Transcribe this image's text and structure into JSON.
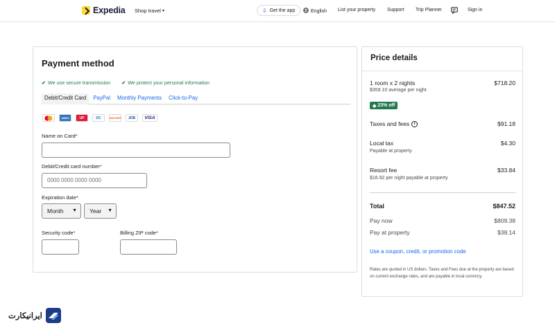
{
  "header": {
    "brand": "Expedia",
    "shop_travel": "Shop travel",
    "get_app": "Get the app",
    "language": "English",
    "list_property": "List your property",
    "support": "Support",
    "trip_planner": "Trip Planner",
    "sign_in": "Sign in"
  },
  "payment": {
    "title": "Payment method",
    "secure_1": "We use secure transmission",
    "secure_2": "We protect your personal information",
    "tabs": [
      "Debit/Credit Card",
      "PayPal",
      "Monthly Payments",
      "Click-to-Pay"
    ],
    "active_tab": "Debit/Credit Card",
    "card_logos": [
      "mastercard-icon",
      "amex-icon",
      "unionpay-icon",
      "diners-icon",
      "discover-icon",
      "jcb-icon",
      "visa-icon"
    ],
    "card_text": {
      "amex": "AMEX",
      "union": "UP",
      "diners": "DC",
      "discover": "DISCOVER",
      "jcb": "JCB",
      "visa": "VISA"
    },
    "name_label": "Name on Card",
    "name_value": "",
    "number_label": "Debit/Credit card number",
    "number_placeholder": "0000 0000 0000 0000",
    "expiry_label": "Expiration date",
    "month_value": "Month",
    "year_value": "Year",
    "cvv_label": "Security code",
    "zip_label": "Billing ZIP code",
    "required_mark": "*"
  },
  "price": {
    "title": "Price details",
    "room_label": "1 room x 2 nights",
    "room_value": "$718.20",
    "room_sub": "$359.10 average per night",
    "discount": "23% off",
    "taxes_label": "Taxes and fees",
    "taxes_value": "$91.18",
    "local_tax_label": "Local tax",
    "local_tax_value": "$4.30",
    "local_tax_sub": "Payable at property",
    "resort_label": "Resort fee",
    "resort_value": "$33.84",
    "resort_sub": "$16.92 per night payable at property",
    "total_label": "Total",
    "total_value": "$847.52",
    "pay_now_label": "Pay now",
    "pay_now_value": "$809.38",
    "pay_property_label": "Pay at property",
    "pay_property_value": "$38.14",
    "coupon_link": "Use a coupon, credit, or promotion code",
    "rates_note": "Rates are quoted in US dollars. Taxes and Fees due at the property are based on current exchange rates, and are payable in local currency."
  },
  "watermark": {
    "text": "ایرانیکارت"
  },
  "colors": {
    "accent_blue": "#1668e3",
    "success_green": "#227950",
    "brand_yellow": "#fddb32",
    "brand_navy": "#191e3b"
  }
}
